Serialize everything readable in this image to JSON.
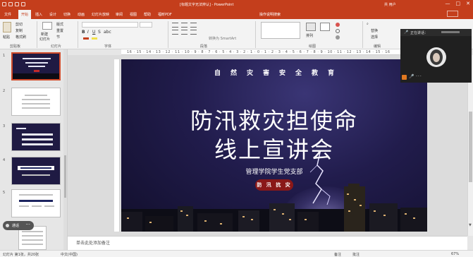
{
  "window": {
    "doc_title": "[标题文字无法辨认] - PowerPoint",
    "user": "共 用户",
    "min_glyph": "—",
    "max_glyph": "□",
    "close_glyph": "✕"
  },
  "tabs": [
    "文件",
    "开始",
    "插入",
    "设计",
    "切换",
    "动画",
    "幻灯片放映",
    "审阅",
    "视图",
    "帮助",
    "福昕PDF"
  ],
  "active_tab": "开始",
  "tell_me": "操作说明搜索",
  "ribbon": {
    "cut": "剪切",
    "copy": "复制",
    "paste": "粘贴",
    "format_painter": "格式刷",
    "new_slide": "新建",
    "slide": "幻灯片",
    "layout": "版式",
    "reset": "重置",
    "section": "节",
    "replace": "替换",
    "select": "选择",
    "arrange": "排列",
    "group_clipboard": "剪贴板",
    "group_slides": "幻灯片",
    "group_font": "字体",
    "group_paragraph": "段落",
    "group_drawing": "绘图",
    "group_editing": "编辑",
    "convert_smartart": "转换为 SmartArt"
  },
  "slides_panel": {
    "numbers": [
      "1",
      "2",
      "3",
      "4",
      "5"
    ],
    "call_pill_label": "通话",
    "call_pill_more": "···"
  },
  "ruler": {
    "ticks": "16 · 15 · 14 · 13 · 12 · 11 · 10 · 9 · 8 · 7 · 6 · 5 · 4 · 3 · 2 · 1 · 0 · 1 · 2 · 3 · 4 · 5 · 6 · 7 · 8 · 9 · 10 · 11 · 12 · 13 · 14 · 15 · 16"
  },
  "slide": {
    "top_subtitle": "自然灾害安全教育",
    "title_line1": "防汛救灾担使命",
    "title_line2": "线上宣讲会",
    "organizer": "管理学院学生党支部",
    "badge": "防 汛 抗 灾"
  },
  "notes": {
    "placeholder": "单击此处添加备注"
  },
  "statusbar": {
    "slide_count": "幻灯片 第1张，共20张",
    "language": "中文(中国)",
    "notes": "备注",
    "comments": "批注",
    "zoom": "67%"
  },
  "call_overlay": {
    "name": "正在讲话：",
    "mic_glyph": "🎤",
    "dots": "···"
  }
}
